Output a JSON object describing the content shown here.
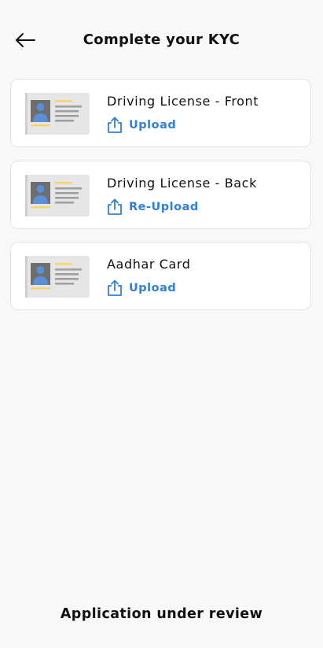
{
  "header": {
    "back_icon": "arrow-left-icon",
    "title": "Complete your KYC"
  },
  "documents": [
    {
      "label": "Driving License - Front",
      "action_label": "Upload",
      "icon": "upload-icon",
      "illustration": "id-card-icon"
    },
    {
      "label": "Driving License - Back",
      "action_label": "Re-Upload",
      "icon": "upload-icon",
      "illustration": "id-card-icon"
    },
    {
      "label": "Aadhar Card",
      "action_label": "Upload",
      "icon": "upload-icon",
      "illustration": "id-card-icon"
    }
  ],
  "footer": {
    "status": "Application under review"
  },
  "colors": {
    "background": "#f8f8f8",
    "card": "#ffffff",
    "accent": "#2f7fde",
    "id_card_body": "#e6e6e6",
    "id_highlight": "#f9d46a",
    "id_text_lines": "#9e9e9e",
    "id_photo_bg": "#6e6e6e",
    "id_person": "#5b8ed6"
  }
}
